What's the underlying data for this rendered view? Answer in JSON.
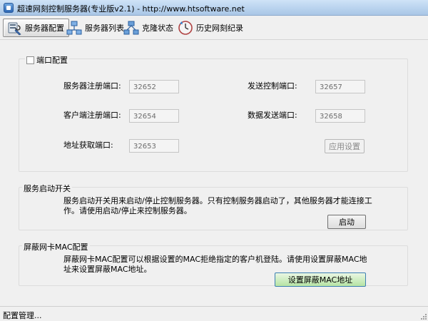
{
  "window": {
    "title": "超速网刻控制服务器(专业版v2.1) - http://www.htsoftware.net"
  },
  "toolbar": {
    "tabs": [
      {
        "label": "服务器配置",
        "icon": "server-config-icon",
        "active": true
      },
      {
        "label": "服务器列表",
        "icon": "network-list-icon",
        "active": false
      },
      {
        "label": "克隆状态",
        "icon": "clone-status-icon",
        "active": false
      },
      {
        "label": "历史网刻纪录",
        "icon": "history-clock-icon",
        "active": false
      }
    ]
  },
  "port_config": {
    "title": "端口配置",
    "checked": false,
    "fields": {
      "server_register_label": "服务器注册端口:",
      "server_register_value": "32652",
      "send_control_label": "发送控制端口:",
      "send_control_value": "32657",
      "client_register_label": "客户端注册端口:",
      "client_register_value": "32654",
      "data_send_label": "数据发送端口:",
      "data_send_value": "32658",
      "address_fetch_label": "地址获取端口:",
      "address_fetch_value": "32653"
    },
    "apply_button": "应用设置"
  },
  "service_switch": {
    "title": "服务启动开关",
    "description": "服务启动开关用来启动/停止控制服务器。只有控制服务器启动了，其他服务器才能连接工作。请使用启动/停止来控制服务器。",
    "start_button": "启动"
  },
  "mac_shield": {
    "title": "屏蔽网卡MAC配置",
    "description": "屏蔽网卡MAC配置可以根据设置的MAC拒绝指定的客户机登陆。请使用设置屏蔽MAC地址来设置屏蔽MAC地址。",
    "set_button": "设置屏蔽MAC地址"
  },
  "statusbar": {
    "text": "配置管理..."
  },
  "colors": {
    "titlebar": "#b9d3ee",
    "window_bg": "#f0f0f0",
    "primary_button": "#cfeec3"
  }
}
